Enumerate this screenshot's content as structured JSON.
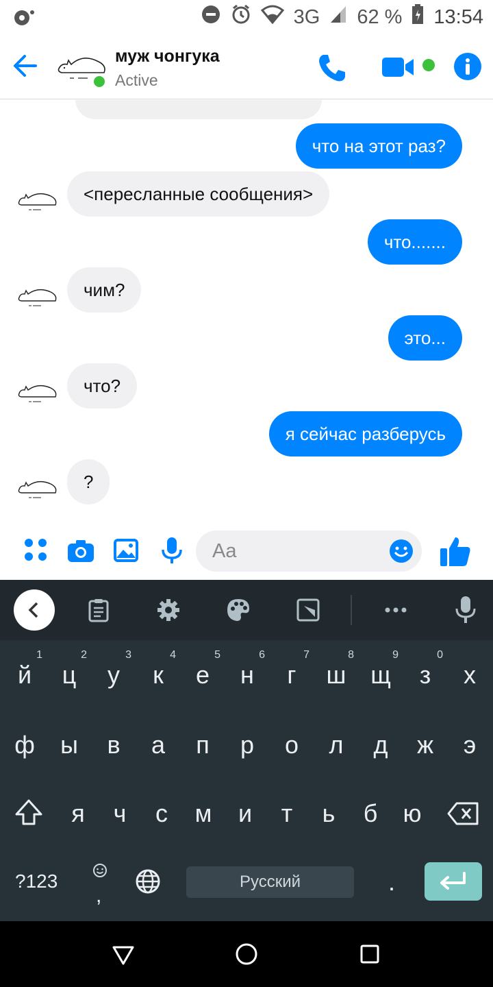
{
  "status_bar": {
    "network": "3G",
    "battery": "62 %",
    "time": "13:54",
    "icons": [
      "notification-icon",
      "dnd-icon",
      "alarm-icon",
      "wifi-icon",
      "signal-icon",
      "battery-icon"
    ]
  },
  "header": {
    "name": "муж чонгука",
    "status": "Active",
    "accent": "#0084ff",
    "online_color": "#3cc13b"
  },
  "messages": [
    {
      "dir": "out",
      "text": "что на этот раз?"
    },
    {
      "dir": "in",
      "text": "<пересланные сообщения>"
    },
    {
      "dir": "out",
      "text": "что......."
    },
    {
      "dir": "in",
      "text": "чим?"
    },
    {
      "dir": "out",
      "text": "это..."
    },
    {
      "dir": "in",
      "text": "что?"
    },
    {
      "dir": "out",
      "text": "я сейчас разберусь"
    },
    {
      "dir": "in",
      "text": "?"
    }
  ],
  "composer": {
    "placeholder": "Aa"
  },
  "keyboard": {
    "row1": [
      "й",
      "ц",
      "у",
      "к",
      "е",
      "н",
      "г",
      "ш",
      "щ",
      "з",
      "х"
    ],
    "row1_hints": [
      "1",
      "2",
      "3",
      "4",
      "5",
      "6",
      "7",
      "8",
      "9",
      "0",
      ""
    ],
    "row2": [
      "ф",
      "ы",
      "в",
      "а",
      "п",
      "р",
      "о",
      "л",
      "д",
      "ж",
      "э"
    ],
    "row3": [
      "я",
      "ч",
      "с",
      "м",
      "и",
      "т",
      "ь",
      "б",
      "ю"
    ],
    "symbols_label": "?123",
    "space_label": "Русский",
    "period": ".",
    "comma": ","
  }
}
